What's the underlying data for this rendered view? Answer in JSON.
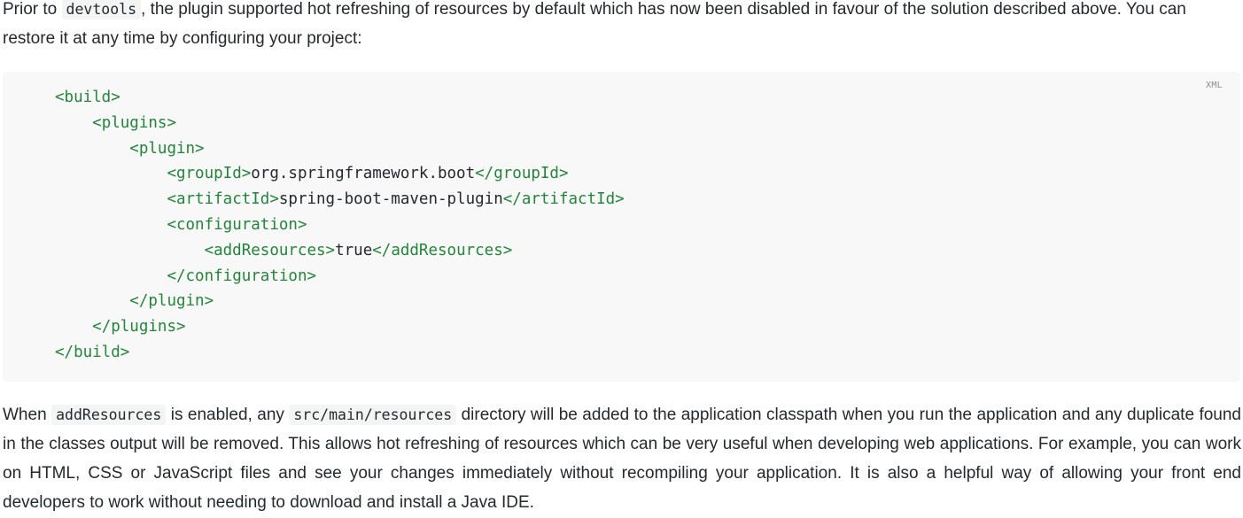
{
  "intro": {
    "text_before_code": "Prior to ",
    "inline_code": "devtools",
    "text_after_code": ", the plugin supported hot refreshing of resources by default which has now been disabled in favour of the solution described above. You can restore it at any time by configuring your project:"
  },
  "code_block": {
    "language_label": "XML",
    "lines": [
      {
        "indent": "",
        "open_tag": "<build>",
        "text": "",
        "close_tag": ""
      },
      {
        "indent": "    ",
        "open_tag": "<plugins>",
        "text": "",
        "close_tag": ""
      },
      {
        "indent": "        ",
        "open_tag": "<plugin>",
        "text": "",
        "close_tag": ""
      },
      {
        "indent": "            ",
        "open_tag": "<groupId>",
        "text": "org.springframework.boot",
        "close_tag": "</groupId>"
      },
      {
        "indent": "            ",
        "open_tag": "<artifactId>",
        "text": "spring-boot-maven-plugin",
        "close_tag": "</artifactId>"
      },
      {
        "indent": "            ",
        "open_tag": "<configuration>",
        "text": "",
        "close_tag": ""
      },
      {
        "indent": "                ",
        "open_tag": "<addResources>",
        "text": "true",
        "close_tag": "</addResources>"
      },
      {
        "indent": "            ",
        "open_tag": "</configuration>",
        "text": "",
        "close_tag": ""
      },
      {
        "indent": "        ",
        "open_tag": "</plugin>",
        "text": "",
        "close_tag": ""
      },
      {
        "indent": "    ",
        "open_tag": "</plugins>",
        "text": "",
        "close_tag": ""
      },
      {
        "indent": "",
        "open_tag": "</build>",
        "text": "",
        "close_tag": ""
      }
    ]
  },
  "outro": {
    "text_1": "When ",
    "code_1": "addResources",
    "text_2": " is enabled, any ",
    "code_2": "src/main/resources",
    "text_3": " directory will be added to the application classpath when you run the application and any du­plicate found in the classes output will be removed. This allows hot refreshing of resources which can be very useful when developing web applications. For example, you can work on HTML, CSS or JavaScript files and see your changes immediately without recompiling your application. It is also a helpful way of allowing your front end developers to work without needing to download and install a Java IDE."
  },
  "colors": {
    "tag": "#22863a",
    "text": "#24292e",
    "code_background": "#f8f8f8",
    "inline_code_background": "#f3f4f4"
  }
}
